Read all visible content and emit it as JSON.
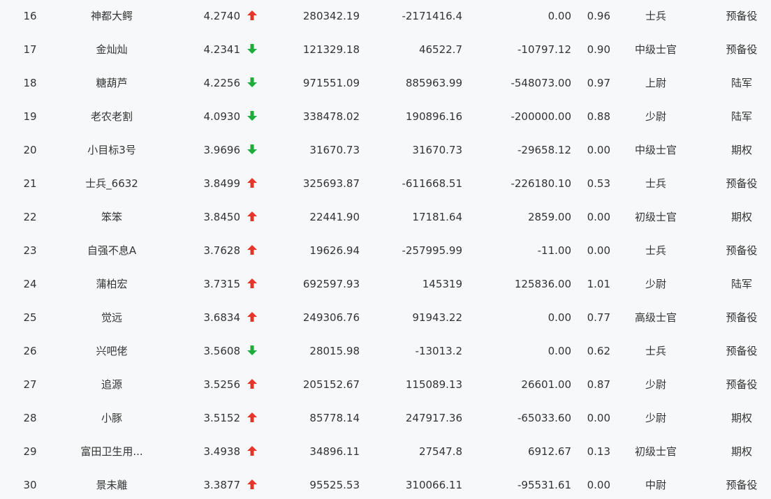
{
  "colors": {
    "up": "#e8332a",
    "down": "#1aad3a",
    "text": "#333333",
    "background": "#f7f8fa"
  },
  "rows": [
    {
      "rank": "16",
      "name": "神都大鳄",
      "score": "4.2740",
      "trend": "up",
      "trend_icon": "arrow-up-icon",
      "v1": "280342.19",
      "v2": "-2171416.4",
      "v3": "0.00",
      "ratio": "0.96",
      "rank_title": "士兵",
      "type": "预备役"
    },
    {
      "rank": "17",
      "name": "金灿灿",
      "score": "4.2341",
      "trend": "down",
      "trend_icon": "arrow-down-icon",
      "v1": "121329.18",
      "v2": "46522.7",
      "v3": "-10797.12",
      "ratio": "0.90",
      "rank_title": "中级士官",
      "type": "预备役"
    },
    {
      "rank": "18",
      "name": "糖葫芦",
      "score": "4.2256",
      "trend": "down",
      "trend_icon": "arrow-down-icon",
      "v1": "971551.09",
      "v2": "885963.99",
      "v3": "-548073.00",
      "ratio": "0.97",
      "rank_title": "上尉",
      "type": "陆军"
    },
    {
      "rank": "19",
      "name": "老农老割",
      "score": "4.0930",
      "trend": "down",
      "trend_icon": "arrow-down-icon",
      "v1": "338478.02",
      "v2": "190896.16",
      "v3": "-200000.00",
      "ratio": "0.88",
      "rank_title": "少尉",
      "type": "陆军"
    },
    {
      "rank": "20",
      "name": "小目标3号",
      "score": "3.9696",
      "trend": "down",
      "trend_icon": "arrow-down-icon",
      "v1": "31670.73",
      "v2": "31670.73",
      "v3": "-29658.12",
      "ratio": "0.00",
      "rank_title": "中级士官",
      "type": "期权"
    },
    {
      "rank": "21",
      "name": "士兵_6632",
      "score": "3.8499",
      "trend": "up",
      "trend_icon": "arrow-up-icon",
      "v1": "325693.87",
      "v2": "-611668.51",
      "v3": "-226180.10",
      "ratio": "0.53",
      "rank_title": "士兵",
      "type": "预备役"
    },
    {
      "rank": "22",
      "name": "笨笨",
      "score": "3.8450",
      "trend": "up",
      "trend_icon": "arrow-up-icon",
      "v1": "22441.90",
      "v2": "17181.64",
      "v3": "2859.00",
      "ratio": "0.00",
      "rank_title": "初级士官",
      "type": "期权"
    },
    {
      "rank": "23",
      "name": "自强不息A",
      "score": "3.7628",
      "trend": "up",
      "trend_icon": "arrow-up-icon",
      "v1": "19626.94",
      "v2": "-257995.99",
      "v3": "-11.00",
      "ratio": "0.00",
      "rank_title": "士兵",
      "type": "预备役"
    },
    {
      "rank": "24",
      "name": "蒲柏宏",
      "score": "3.7315",
      "trend": "up",
      "trend_icon": "arrow-up-icon",
      "v1": "692597.93",
      "v2": "145319",
      "v3": "125836.00",
      "ratio": "1.01",
      "rank_title": "少尉",
      "type": "陆军"
    },
    {
      "rank": "25",
      "name": "觉远",
      "score": "3.6834",
      "trend": "up",
      "trend_icon": "arrow-up-icon",
      "v1": "249306.76",
      "v2": "91943.22",
      "v3": "0.00",
      "ratio": "0.77",
      "rank_title": "高级士官",
      "type": "预备役"
    },
    {
      "rank": "26",
      "name": "兴吧佬",
      "score": "3.5608",
      "trend": "down",
      "trend_icon": "arrow-down-icon",
      "v1": "28015.98",
      "v2": "-13013.2",
      "v3": "0.00",
      "ratio": "0.62",
      "rank_title": "士兵",
      "type": "预备役"
    },
    {
      "rank": "27",
      "name": "追源",
      "score": "3.5256",
      "trend": "up",
      "trend_icon": "arrow-up-icon",
      "v1": "205152.67",
      "v2": "115089.13",
      "v3": "26601.00",
      "ratio": "0.87",
      "rank_title": "少尉",
      "type": "预备役"
    },
    {
      "rank": "28",
      "name": "小豚",
      "score": "3.5152",
      "trend": "up",
      "trend_icon": "arrow-up-icon",
      "v1": "85778.14",
      "v2": "247917.36",
      "v3": "-65033.60",
      "ratio": "0.00",
      "rank_title": "少尉",
      "type": "期权"
    },
    {
      "rank": "29",
      "name": "富田卫生用...",
      "score": "3.4938",
      "trend": "up",
      "trend_icon": "arrow-up-icon",
      "v1": "34896.11",
      "v2": "27547.8",
      "v3": "6912.67",
      "ratio": "0.13",
      "rank_title": "初级士官",
      "type": "期权"
    },
    {
      "rank": "30",
      "name": "景未離",
      "score": "3.3877",
      "trend": "up",
      "trend_icon": "arrow-up-icon",
      "v1": "95525.53",
      "v2": "310066.11",
      "v3": "-95531.61",
      "ratio": "0.00",
      "rank_title": "中尉",
      "type": "预备役"
    }
  ]
}
